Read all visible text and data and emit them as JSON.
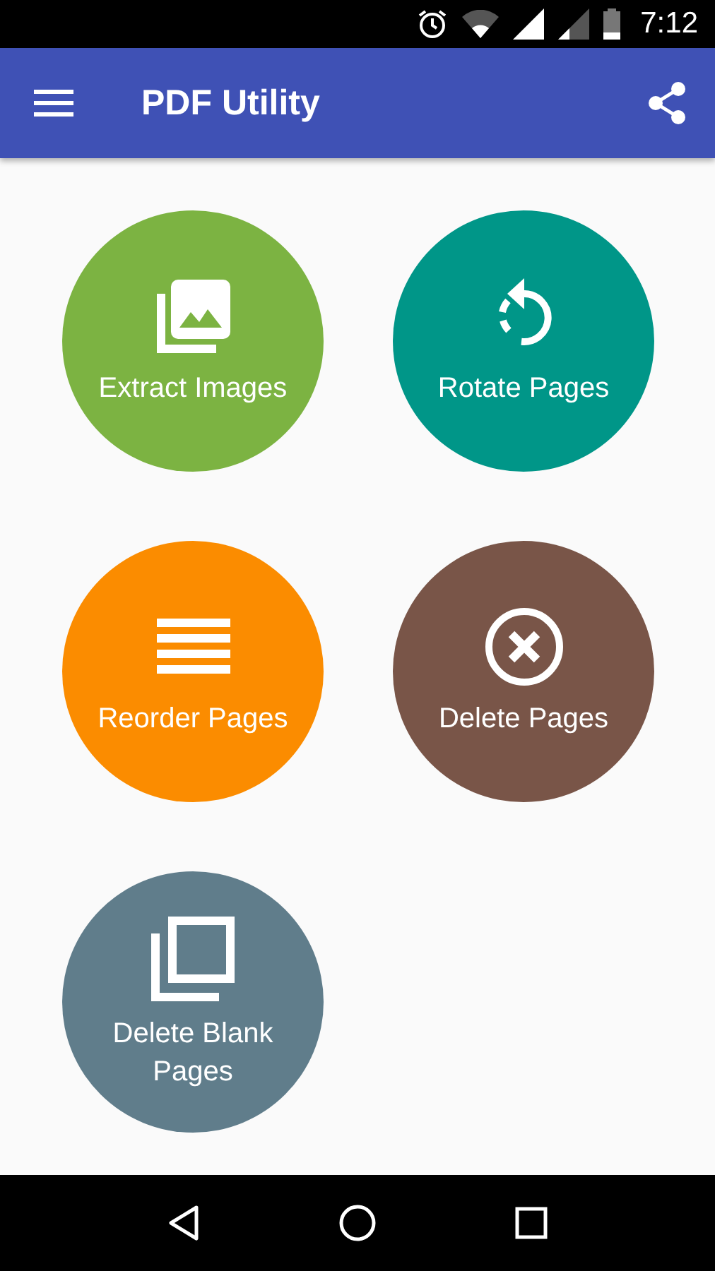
{
  "status_bar": {
    "time": "7:12"
  },
  "app_bar": {
    "title": "PDF Utility"
  },
  "tools": [
    {
      "label": "Extract Images",
      "kind": "images",
      "color": "#7cb342"
    },
    {
      "label": "Rotate Pages",
      "kind": "rotate",
      "color": "#009688"
    },
    {
      "label": "Reorder Pages",
      "kind": "reorder",
      "color": "#fb8c00"
    },
    {
      "label": "Delete Pages",
      "kind": "delete",
      "color": "#795548"
    },
    {
      "label": "Delete Blank Pages",
      "kind": "blank",
      "color": "#607d8b"
    }
  ]
}
